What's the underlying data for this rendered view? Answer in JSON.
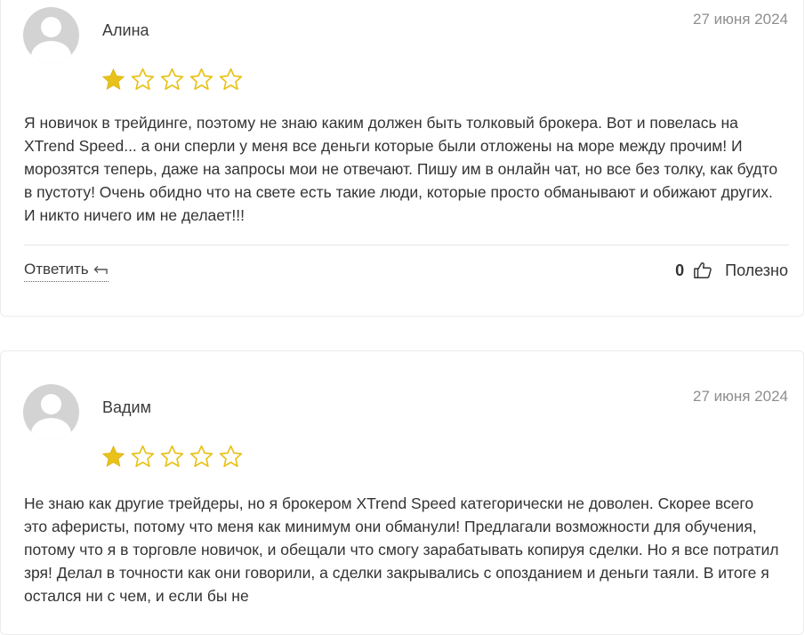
{
  "colors": {
    "star_filled": "#e8c21a",
    "star_outline": "#e8c21a",
    "avatar_bg": "#d3d3d3",
    "date_text": "#8e8e8e",
    "border": "#ececec"
  },
  "reviews": [
    {
      "author": "Алина",
      "date": "27 июня 2024",
      "rating": 1,
      "rating_max": 5,
      "text": "Я новичок в трейдинге, поэтому не знаю каким должен быть толковый брокера. Вот и повелась на XTrend Speed... а они сперли у меня все деньги которые были отложены на море между прочим! И морозятся теперь, даже на запросы мои не отвечают. Пишу им в онлайн чат, но все без толку, как будто в пустоту! Очень обидно что на свете есть такие люди, которые просто обманывают и обижают других. И никто ничего им не делает!!!",
      "reply_label": "Ответить",
      "useful_count": "0",
      "useful_label": "Полезно",
      "icons": {
        "reply": "reply-arrow-icon",
        "like": "thumbs-up-icon"
      }
    },
    {
      "author": "Вадим",
      "date": "27 июня 2024",
      "rating": 1,
      "rating_max": 5,
      "text": "Не знаю как другие трейдеры, но я брокером XTrend Speed категорически не доволен. Скорее всего это аферисты, потому что меня как минимум они обманули! Предлагали возможности для обучения, потому что я в торговле новичок, и обещали что смогу зарабатывать копируя сделки. Но я все потратил зря! Делал в точности как они говорили, а сделки закрывались с опозданием и деньги таяли. В итоге я остался ни с чем, и если бы не"
    }
  ]
}
